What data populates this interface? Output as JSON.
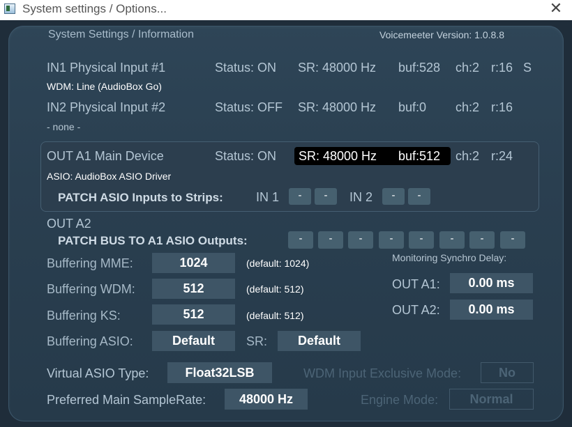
{
  "window": {
    "title": "System settings / Options..."
  },
  "header": {
    "title": "System Settings / Information",
    "version": "Voicemeeter Version: 1.0.8.8"
  },
  "in1": {
    "label": "IN1 Physical Input #1",
    "status": "Status: ON",
    "sr": "SR: 48000 Hz",
    "buf": "buf:528",
    "ch": "ch:2",
    "r": "r:16",
    "flag": "S",
    "device": "WDM: Line (AudioBox Go)"
  },
  "in2": {
    "label": "IN2 Physical Input #2",
    "status": "Status: OFF",
    "sr": "SR: 48000 Hz",
    "buf": "buf:0",
    "ch": "ch:2",
    "r": "r:16",
    "device": "- none -"
  },
  "outa1": {
    "label": "OUT A1 Main Device",
    "status": "Status: ON",
    "sr": "SR: 48000 Hz",
    "buf": "buf:512",
    "ch": "ch:2",
    "r": "r:24",
    "device": "ASIO: AudioBox ASIO Driver",
    "patch_label": "PATCH ASIO Inputs to Strips:",
    "in1_label": "IN 1",
    "in2_label": "IN 2",
    "patch_value": "-"
  },
  "outa2": {
    "label": "OUT A2",
    "patch_label": "PATCH BUS TO A1 ASIO Outputs:",
    "patch_buttons": [
      "-",
      "-",
      "-",
      "-",
      "-",
      "-",
      "-",
      "-"
    ]
  },
  "buffering": {
    "mme": {
      "label": "Buffering MME:",
      "value": "1024",
      "default": "(default: 1024)"
    },
    "wdm": {
      "label": "Buffering WDM:",
      "value": "512",
      "default": "(default: 512)"
    },
    "ks": {
      "label": "Buffering KS:",
      "value": "512",
      "default": "(default: 512)"
    },
    "asio": {
      "label": "Buffering ASIO:",
      "value": "Default",
      "sr_label": "SR:",
      "sr_value": "Default"
    }
  },
  "monitoring": {
    "title": "Monitoring Synchro Delay:",
    "a1_label": "OUT A1:",
    "a1_value": "0.00 ms",
    "a2_label": "OUT A2:",
    "a2_value": "0.00 ms"
  },
  "virtual_asio": {
    "label": "Virtual ASIO Type:",
    "value": "Float32LSB"
  },
  "samplerate": {
    "label": "Preferred Main SampleRate:",
    "value": "48000 Hz"
  },
  "wdm_exclusive": {
    "label": "WDM Input Exclusive Mode:",
    "value": "No"
  },
  "engine": {
    "label": "Engine Mode:",
    "value": "Normal"
  },
  "colors": {
    "panel": "#2a3f50",
    "button": "#3e5566",
    "highlight": "#000000"
  }
}
